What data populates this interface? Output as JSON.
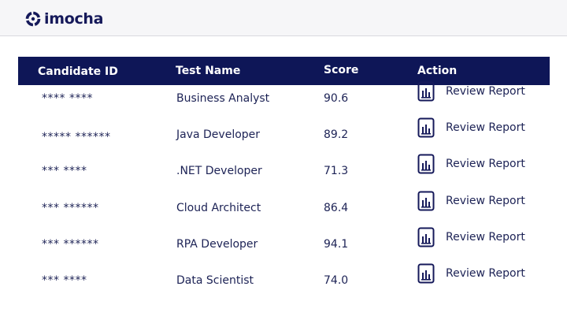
{
  "brand": {
    "name": "imocha"
  },
  "table": {
    "headers": {
      "candidate_id": "Candidate ID",
      "test_name": "Test Name",
      "score": "Score",
      "action": "Action"
    },
    "rows": [
      {
        "candidate_id": "**** ****",
        "test_name": "Business Analyst",
        "score": "90.6",
        "action": "Review Report"
      },
      {
        "candidate_id": "***** ******",
        "test_name": "Java Developer",
        "score": "89.2",
        "action": "Review Report"
      },
      {
        "candidate_id": "*** ****",
        "test_name": ".NET Developer",
        "score": "71.3",
        "action": "Review Report"
      },
      {
        "candidate_id": "*** ******",
        "test_name": "Cloud Architect",
        "score": "86.4",
        "action": "Review Report"
      },
      {
        "candidate_id": "*** ******",
        "test_name": "RPA Developer",
        "score": "94.1",
        "action": "Review Report"
      },
      {
        "candidate_id": "*** ****",
        "test_name": "Data Scientist",
        "score": "74.0",
        "action": "Review Report"
      }
    ]
  },
  "colors": {
    "brand_navy": "#0e1657",
    "text": "#1c2255",
    "topbar": "#f6f6f8"
  },
  "icons": {
    "logo": "imocha-logo-icon",
    "report": "report-chart-icon"
  }
}
